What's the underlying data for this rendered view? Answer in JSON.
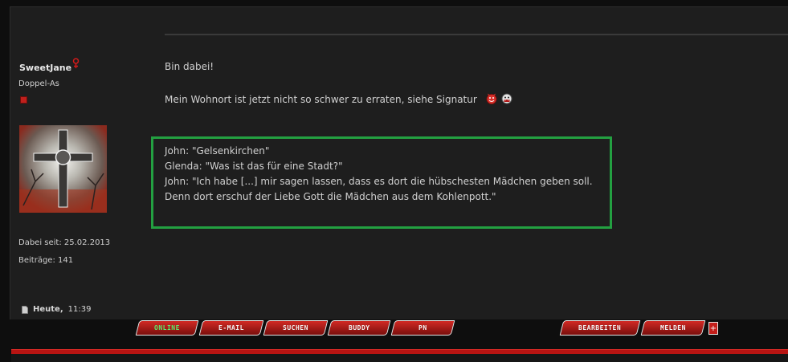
{
  "user": {
    "name": "SweetJane",
    "rank": "Doppel-As",
    "joined": "Dabei seit: 25.02.2013",
    "posts": "Beiträge: 141"
  },
  "post": {
    "line1": "Bin dabei!",
    "line2": "Mein Wohnort ist jetzt nicht so schwer zu erraten, siehe Signatur",
    "quote": [
      "John: \"Gelsenkirchen\"",
      "Glenda: \"Was ist das für eine Stadt?\"",
      "John: \"Ich habe [...] mir sagen lassen, dass es dort die hübschesten Mädchen geben soll.",
      "Denn dort erschuf der Liebe Gott die Mädchen aus dem Kohlenpott.\""
    ]
  },
  "footer": {
    "day": "Heute,",
    "time": "11:39"
  },
  "buttons": {
    "online": "ONLINE",
    "email": "E-MAIL",
    "search": "SUCHEN",
    "buddy": "BUDDY",
    "pm": "PN",
    "edit": "BEARBEITEN",
    "report": "MELDEN",
    "quote_plus": "+"
  },
  "colors": {
    "quote_border": "#23a041",
    "button_red": "#d22a25",
    "online_green": "#5ee86a"
  }
}
